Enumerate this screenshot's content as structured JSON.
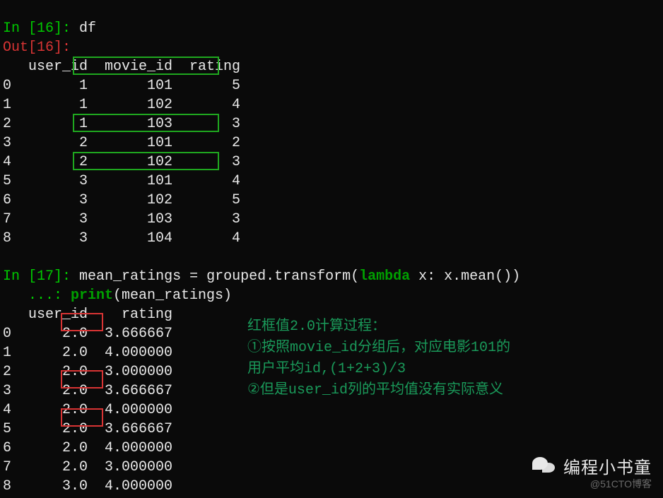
{
  "cell16": {
    "prompt_in": "In [",
    "prompt_num": "16",
    "prompt_close": "]: ",
    "code": "df",
    "out_prompt": "Out[",
    "out_num": "16",
    "out_close": "]:",
    "header": "   user_id  movie_id  rating",
    "rows": [
      "0        1       101       5",
      "1        1       102       4",
      "2        1       103       3",
      "3        2       101       2",
      "4        2       102       3",
      "5        3       101       4",
      "6        3       102       5",
      "7        3       103       3",
      "8        3       104       4"
    ]
  },
  "cell17": {
    "prompt_in": "In [",
    "prompt_num": "17",
    "prompt_close": "]: ",
    "code_pre": "mean_ratings = grouped.transform(",
    "kw": "lambda",
    "code_mid": " x: x.mean())",
    "cont": "   ...: ",
    "line2_pre": "print",
    "line2_post": "(mean_ratings)",
    "header": "   user_id    rating",
    "rows": [
      "0      2.0  3.666667",
      "1      2.0  4.000000",
      "2      2.0  3.000000",
      "3      2.0  3.666667",
      "4      2.0  4.000000",
      "5      2.0  3.666667",
      "6      2.0  4.000000",
      "7      2.0  3.000000",
      "8      3.0  4.000000"
    ]
  },
  "annotation": {
    "line1": "红框值2.0计算过程：",
    "line2": "①按照movie_id分组后，对应电影101的",
    "line3": "用户平均id,(1+2+3)/3",
    "line4": "②但是user_id列的平均值没有实际意义"
  },
  "watermark": {
    "main": "编程小书童",
    "sub": "@51CTO博客"
  }
}
